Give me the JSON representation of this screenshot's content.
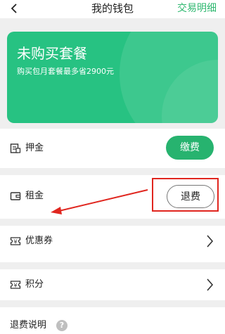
{
  "header": {
    "title": "我的钱包",
    "records_link": "交易明细"
  },
  "promo_card": {
    "title": "未购买套餐",
    "subtitle": "购买包月套餐最多省2900元"
  },
  "rows": {
    "deposit": {
      "label": "押金",
      "button": "缴费",
      "icon": "deposit-card-icon"
    },
    "rent": {
      "label": "租金",
      "button": "退费",
      "icon": "wallet-icon"
    },
    "coupon": {
      "label": "优惠券",
      "icon": "yen-ticket-icon"
    },
    "points": {
      "label": "积分",
      "icon": "yen-ticket-icon"
    }
  },
  "footer": {
    "refund_note": "退费说明",
    "help_icon": "question-icon"
  },
  "colors": {
    "accent": "#27b36f",
    "card": "#27c282",
    "annotation": "#e0261f"
  }
}
